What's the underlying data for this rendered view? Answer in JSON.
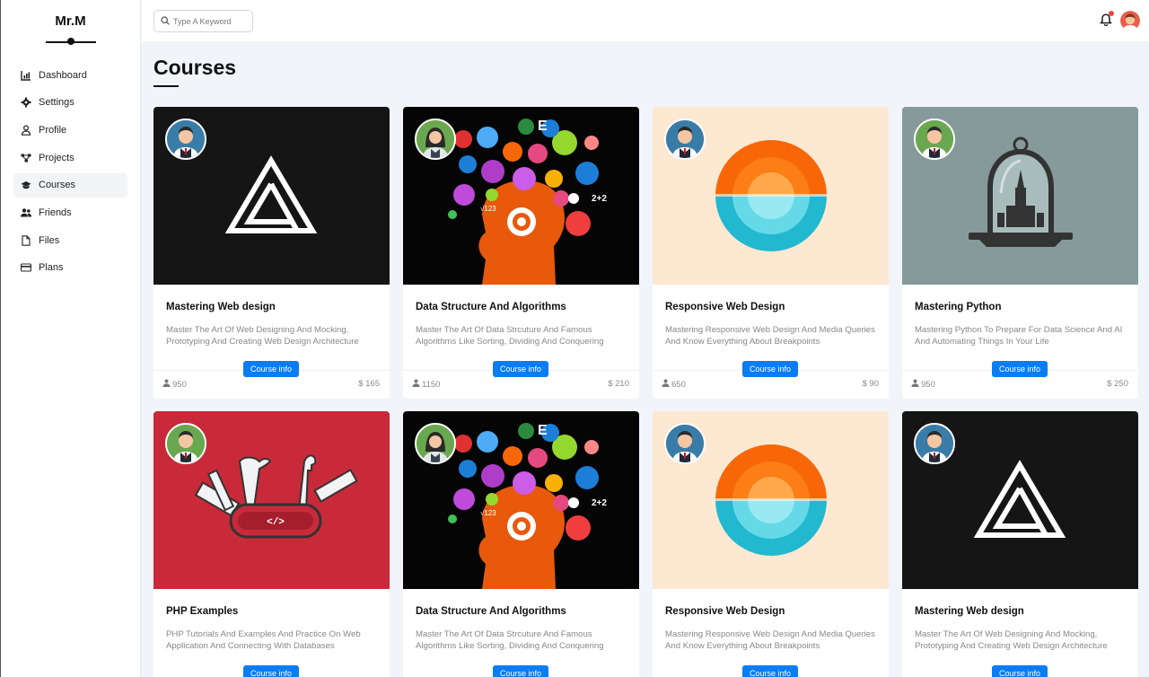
{
  "brand": "Mr.M",
  "sidebar": {
    "items": [
      {
        "label": "Dashboard",
        "icon": "chart-icon"
      },
      {
        "label": "Settings",
        "icon": "gear-icon"
      },
      {
        "label": "Profile",
        "icon": "user-icon"
      },
      {
        "label": "Projects",
        "icon": "projects-icon"
      },
      {
        "label": "Courses",
        "icon": "graduation-cap-icon",
        "active": true
      },
      {
        "label": "Friends",
        "icon": "users-icon"
      },
      {
        "label": "Files",
        "icon": "file-icon"
      },
      {
        "label": "Plans",
        "icon": "credit-card-icon"
      }
    ]
  },
  "header": {
    "search_placeholder": "Type A Keyword",
    "has_notification": true
  },
  "page": {
    "title": "Courses"
  },
  "colors": {
    "accent": "#0a7cf4",
    "notification": "#ef4444"
  },
  "courses": [
    {
      "title": "Mastering Web design",
      "desc": "Master The Art Of Web Designing And Mocking, Prototyping And Creating Web Design Architecture",
      "button": "Course info",
      "students": "950",
      "price": "$ 165",
      "image": "triangle-logo"
    },
    {
      "title": "Data Structure And Algorithms",
      "desc": "Master The Art Of Data Strcuture And Famous Algorithms Like Sorting, Dividing And Conquering",
      "button": "Course info",
      "students": "1150",
      "price": "$ 210",
      "image": "brain-head"
    },
    {
      "title": "Responsive Web Design",
      "desc": "Mastering Responsive Web Design And Media Queries And Know Everything About Breakpoints",
      "button": "Course info",
      "students": "650",
      "price": "$ 90",
      "image": "sunset-circle"
    },
    {
      "title": "Mastering Python",
      "desc": "Mastering Python To Prepare For Data Science And AI And Automating Things In Your Life",
      "button": "Course info",
      "students": "950",
      "price": "$ 250",
      "image": "bell-jar"
    },
    {
      "title": "PHP Examples",
      "desc": "PHP Tutorials And Examples And Practice On Web Application And Connecting With Databases",
      "button": "Course info",
      "students": "",
      "price": "",
      "image": "tool-knife"
    },
    {
      "title": "Data Structure And Algorithms",
      "desc": "Master The Art Of Data Strcuture And Famous Algorithms Like Sorting, Dividing And Conquering",
      "button": "Course info",
      "students": "",
      "price": "",
      "image": "brain-head"
    },
    {
      "title": "Responsive Web Design",
      "desc": "Mastering Responsive Web Design And Media Queries And Know Everything About Breakpoints",
      "button": "Course info",
      "students": "",
      "price": "",
      "image": "sunset-circle"
    },
    {
      "title": "Mastering Web design",
      "desc": "Master The Art Of Web Designing And Mocking, Prototyping And Creating Web Design Architecture",
      "button": "Course info",
      "students": "",
      "price": "",
      "image": "triangle-logo"
    }
  ]
}
